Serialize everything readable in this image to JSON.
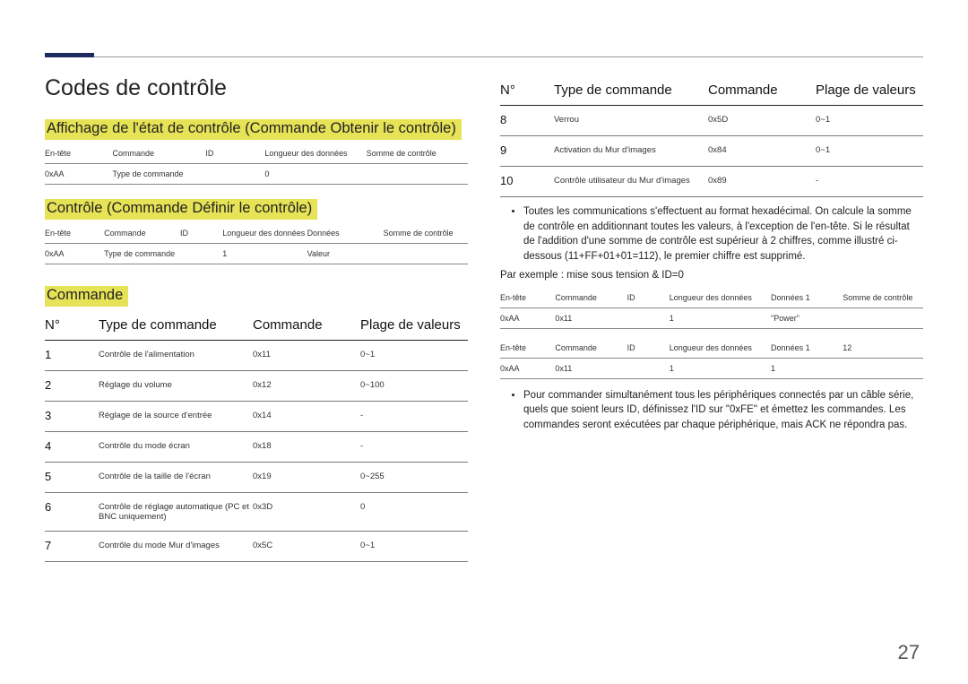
{
  "page_number": "27",
  "title": "Codes de contrôle",
  "section_get": "Affichage de l'état de contrôle (Commande Obtenir le contrôle)",
  "section_set": "Contrôle (Commande Définir le contrôle)",
  "section_cmd": "Commande",
  "table_get": {
    "h": [
      "En-tête",
      "Commande",
      "ID",
      "Longueur des données",
      "Somme de contrôle"
    ],
    "r": [
      "0xAA",
      "Type de commande",
      "",
      "0",
      ""
    ]
  },
  "table_set": {
    "h": [
      "En-tête",
      "Commande",
      "ID",
      "Longueur des données",
      "Données",
      "Somme de contrôle"
    ],
    "r": [
      "0xAA",
      "Type de commande",
      "",
      "1",
      "Valeur",
      ""
    ]
  },
  "cmd_headers": {
    "no": "N°",
    "type": "Type de commande",
    "cmd": "Commande",
    "range": "Plage de valeurs"
  },
  "commands": [
    {
      "no": "1",
      "type": "Contrôle de l'alimentation",
      "cmd": "0x11",
      "range": "0~1"
    },
    {
      "no": "2",
      "type": "Réglage du volume",
      "cmd": "0x12",
      "range": "0~100"
    },
    {
      "no": "3",
      "type": "Réglage de la source d'entrée",
      "cmd": "0x14",
      "range": "-"
    },
    {
      "no": "4",
      "type": "Contrôle du mode écran",
      "cmd": "0x18",
      "range": "-"
    },
    {
      "no": "5",
      "type": "Contrôle de la taille de l'écran",
      "cmd": "0x19",
      "range": "0~255"
    },
    {
      "no": "6",
      "type": "Contrôle de réglage automatique (PC et BNC uniquement)",
      "cmd": "0x3D",
      "range": "0"
    },
    {
      "no": "7",
      "type": "Contrôle du mode Mur d'images",
      "cmd": "0x5C",
      "range": "0~1"
    },
    {
      "no": "8",
      "type": "Verrou",
      "cmd": "0x5D",
      "range": "0~1"
    },
    {
      "no": "9",
      "type": "Activation du Mur d'images",
      "cmd": "0x84",
      "range": "0~1"
    },
    {
      "no": "10",
      "type": "Contrôle utilisateur du Mur d'images",
      "cmd": "0x89",
      "range": "-"
    }
  ],
  "bullet1": "Toutes les communications s'effectuent au format hexadécimal. On calcule la somme de contrôle en additionnant toutes les valeurs, à l'exception de l'en-tête. Si le résultat de l'addition d'une somme de contrôle est supérieur à 2 chiffres, comme illustré ci-dessous (11+FF+01+01=112), le premier chiffre est supprimé.",
  "example_line": "Par exemple : mise sous tension & ID=0",
  "ex_table1": {
    "h": [
      "En-tête",
      "Commande",
      "ID",
      "Longueur des données",
      "Données 1",
      "Somme de contrôle"
    ],
    "r": [
      "0xAA",
      "0x11",
      "",
      "1",
      "\"Power\"",
      ""
    ]
  },
  "ex_table2": {
    "h": [
      "En-tête",
      "Commande",
      "ID",
      "Longueur des données",
      "Données 1",
      "12"
    ],
    "r": [
      "0xAA",
      "0x11",
      "",
      "1",
      "1",
      ""
    ]
  },
  "bullet2": "Pour commander simultanément tous les périphériques connectés par un câble série, quels que soient leurs ID, définissez l'ID sur \"0xFE\" et émettez les commandes. Les commandes seront exécutées par chaque périphérique, mais ACK ne répondra pas."
}
